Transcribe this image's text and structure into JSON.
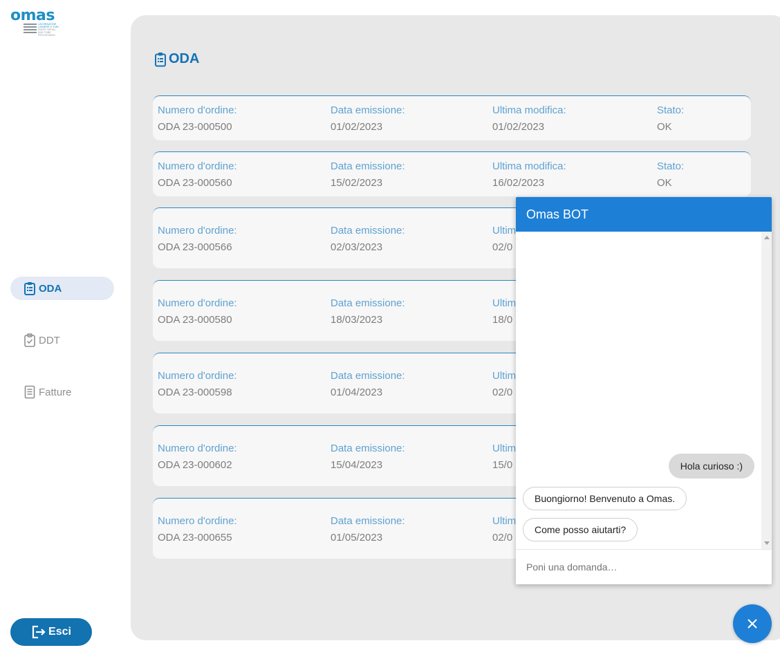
{
  "brand": {
    "logo_word": "omas",
    "logo_sub": [
      "LAVORAZIONE",
      "LAMIERE E TUBI",
      "SHEET METAL",
      "AND TUBE",
      "PROCESSING"
    ]
  },
  "nav": {
    "items": [
      {
        "label": "ODA",
        "icon": "clipboard-list-icon",
        "active": true
      },
      {
        "label": "DDT",
        "icon": "clipboard-check-icon",
        "active": false
      },
      {
        "label": "Fatture",
        "icon": "document-icon",
        "active": false
      }
    ],
    "logout_label": "Esci",
    "logout_icon": "logout-icon"
  },
  "page": {
    "title": "ODA",
    "title_icon": "clipboard-list-icon"
  },
  "labels": {
    "order_number": "Numero d'ordine:",
    "issue_date": "Data emissione:",
    "last_modified": "Ultima modifica:",
    "status": "Stato:"
  },
  "orders": [
    {
      "order_number": "ODA 23-000500",
      "issue_date": "01/02/2023",
      "last_modified": "01/02/2023",
      "status": "OK"
    },
    {
      "order_number": "ODA 23-000560",
      "issue_date": "15/02/2023",
      "last_modified": "16/02/2023",
      "status": "OK"
    },
    {
      "order_number": "ODA 23-000566",
      "issue_date": "02/03/2023",
      "last_modified": "02/0"
    },
    {
      "order_number": "ODA 23-000580",
      "issue_date": "18/03/2023",
      "last_modified": "18/0"
    },
    {
      "order_number": "ODA 23-000598",
      "issue_date": "01/04/2023",
      "last_modified": "02/0"
    },
    {
      "order_number": "ODA 23-000602",
      "issue_date": "15/04/2023",
      "last_modified": "15/0"
    },
    {
      "order_number": "ODA 23-000655",
      "issue_date": "01/05/2023",
      "last_modified": "02/0"
    }
  ],
  "label_truncated": {
    "last_modified": "Ultim"
  },
  "chat": {
    "title": "Omas BOT",
    "messages": [
      {
        "from": "user",
        "text": "Hola curioso :)"
      },
      {
        "from": "bot",
        "text": "Buongiorno! Benvenuto a Omas."
      },
      {
        "from": "bot",
        "text": "Come posso aiutarti?"
      }
    ],
    "input_placeholder": "Poni una domanda…",
    "close_icon": "close-icon"
  },
  "colors": {
    "accent": "#1572b6",
    "chat_accent": "#1e7fd6",
    "panel_bg": "#e8e8e8",
    "card_bg": "#f7f7f7"
  }
}
